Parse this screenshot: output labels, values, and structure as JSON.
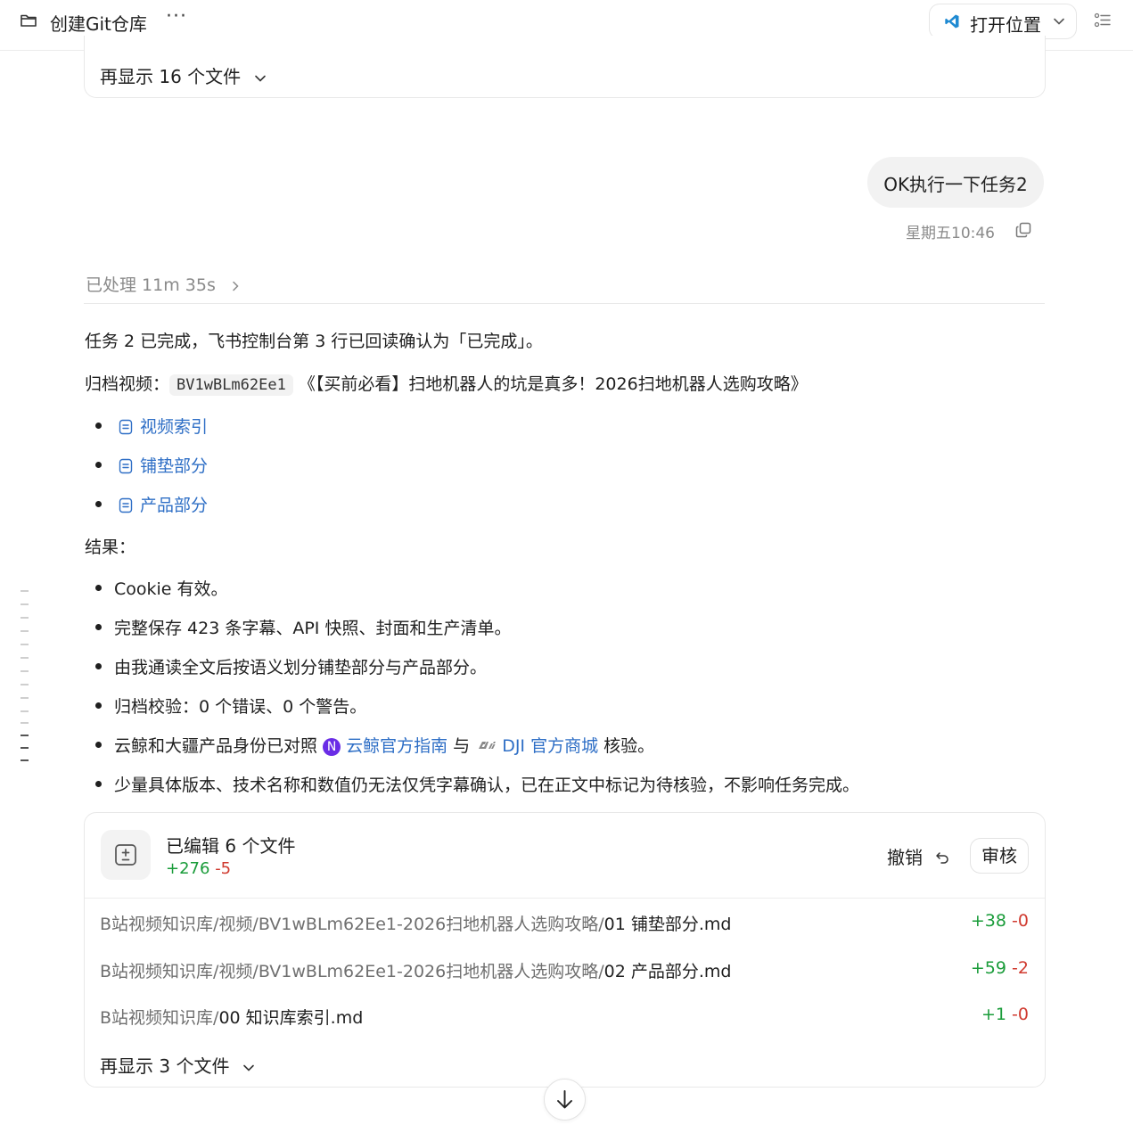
{
  "header": {
    "title": "创建Git仓库",
    "more": "···",
    "open_location": "打开位置"
  },
  "top_card": {
    "show_more": "再显示 16 个文件"
  },
  "user_message": {
    "text": "OK执行一下任务2",
    "timestamp": "星期五10:46"
  },
  "processed": "已处理 11m 35s",
  "reply": {
    "line1": "任务 2 已完成，飞书控制台第 3 行已回读确认为「已完成」。",
    "archive_prefix": "归档视频：",
    "archive_code": "BV1wBLm62Ee1",
    "archive_title": "《【买前必看】扫地机器人的坑是真多！2026扫地机器人选购攻略》",
    "docs": [
      "视频索引",
      "铺垫部分",
      "产品部分"
    ],
    "result_label": "结果：",
    "results": {
      "r1": "Cookie 有效。",
      "r2": "完整保存 423 条字幕、API 快照、封面和生产清单。",
      "r3": "由我通读全文后按语义划分铺垫部分与产品部分。",
      "r4": "归档校验：0 个错误、0 个警告。",
      "r5_prefix": "云鲸和大疆产品身份已对照",
      "r5_badge": "N",
      "r5_link1": "云鲸官方指南",
      "r5_mid": "与",
      "r5_link2": "DJI 官方商城",
      "r5_suffix": "核验。",
      "r6": "少量具体版本、技术名称和数值仍无法仅凭字幕确认，已在正文中标记为待核验，不影响任务完成。"
    }
  },
  "edits": {
    "title": "已编辑 6 个文件",
    "added": "+276",
    "removed": "-5",
    "undo": "撤销",
    "review": "审核",
    "files": [
      {
        "dir": "B站视频知识库/视频/BV1wBLm62Ee1-2026扫地机器人选购攻略/",
        "name": "01 铺垫部分.md",
        "added": "+38",
        "removed": "-0"
      },
      {
        "dir": "B站视频知识库/视频/BV1wBLm62Ee1-2026扫地机器人选购攻略/",
        "name": "02 产品部分.md",
        "added": "+59",
        "removed": "-2"
      },
      {
        "dir": "B站视频知识库/",
        "name": "00 知识库索引.md",
        "added": "+1",
        "removed": "-0"
      }
    ],
    "show_more": "再显示 3 个文件"
  },
  "colors": {
    "link": "#2f6fc6",
    "added": "#1a9c3a",
    "removed": "#d03a2f",
    "badge": "#6a2ce6"
  },
  "icons": [
    "folder-icon",
    "more-icon",
    "vscode-icon",
    "chevron-down-icon",
    "list-icon",
    "copy-icon",
    "chevron-right-icon",
    "doc-icon",
    "diff-icon",
    "undo-icon",
    "arrow-down-icon",
    "dji-logo"
  ]
}
